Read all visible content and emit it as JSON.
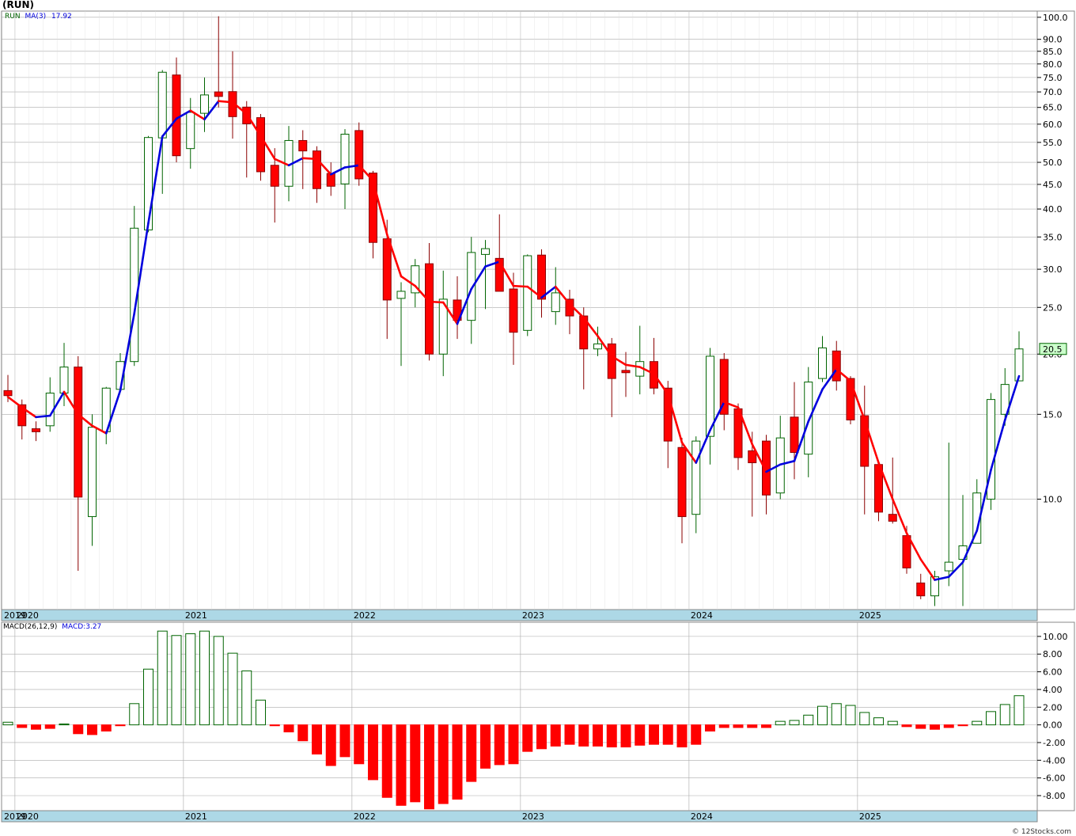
{
  "title": "(RUN)",
  "copyright": "© 12Stocks.com",
  "colors": {
    "up_candle_fill": "#ffffff",
    "up_candle_stroke": "#006400",
    "down_candle_fill": "#ff0000",
    "down_candle_stroke": "#8b0000",
    "ma_up": "#0000dd",
    "ma_down": "#ff0000",
    "macd_pos_fill": "#ffffff",
    "macd_pos_stroke": "#006400",
    "macd_neg_fill": "#ff0000",
    "grid": "#aaaaaa",
    "axis_band": "#add8e6",
    "last_price_box": "#ccffcc"
  },
  "legend": {
    "symbol": "RUN",
    "ma_label": "MA(3)",
    "ma_value": "17.92",
    "macd_label": "MACD(26,12,9)",
    "macd_value": "MACD:3.27"
  },
  "last_price_label": "20.5",
  "chart_data": [
    {
      "type": "candlestick",
      "period": "monthly",
      "scale": "log",
      "ylim": [
        5.9,
        103
      ],
      "y_ticks": [
        "100.0",
        "90.0",
        "85.0",
        "80.0",
        "75.0",
        "70.0",
        "65.0",
        "60.0",
        "55.0",
        "50.0",
        "45.0",
        "40.0",
        "35.0",
        "30.0",
        "25.0",
        "20.0",
        "15.0",
        "10.0"
      ],
      "x_year_labels": [
        "2019",
        "2020",
        "2021",
        "2022",
        "2023",
        "2024",
        "2025"
      ],
      "x_year_month_index": [
        0,
        1,
        13,
        25,
        37,
        49,
        61
      ],
      "ohlc": [
        [
          16.8,
          18.1,
          15.9,
          16.4
        ],
        [
          15.7,
          16.1,
          13.3,
          14.2
        ],
        [
          14.0,
          14.5,
          13.2,
          13.8
        ],
        [
          14.2,
          17.9,
          13.8,
          16.6
        ],
        [
          16.6,
          21.1,
          15.6,
          18.8
        ],
        [
          18.8,
          19.8,
          7.1,
          10.1
        ],
        [
          9.2,
          15.0,
          8.0,
          14.1
        ],
        [
          13.8,
          17.1,
          13.0,
          17.0
        ],
        [
          16.9,
          20.1,
          16.7,
          19.3
        ],
        [
          19.3,
          40.6,
          18.9,
          36.5
        ],
        [
          36.2,
          56.7,
          35.8,
          56.3
        ],
        [
          56.2,
          77.7,
          43.0,
          76.9
        ],
        [
          75.9,
          82.5,
          50.0,
          51.6
        ],
        [
          53.4,
          68.0,
          48.5,
          63.5
        ],
        [
          63.2,
          75.0,
          57.8,
          69.0
        ],
        [
          70.0,
          100.5,
          65.0,
          68.5
        ],
        [
          70.1,
          85.0,
          56.0,
          62.2
        ],
        [
          65.1,
          67.0,
          46.5,
          60.1
        ],
        [
          61.9,
          63.0,
          45.8,
          47.8
        ],
        [
          49.3,
          53.5,
          37.5,
          44.6
        ],
        [
          44.6,
          59.5,
          41.5,
          55.5
        ],
        [
          55.5,
          58.3,
          44.0,
          52.8
        ],
        [
          52.8,
          54.0,
          41.2,
          44.1
        ],
        [
          47.4,
          50.0,
          42.6,
          44.6
        ],
        [
          45.1,
          58.6,
          40.0,
          57.2
        ],
        [
          58.2,
          60.5,
          44.7,
          46.2
        ],
        [
          47.5,
          48.0,
          31.6,
          34.1
        ],
        [
          34.7,
          38.0,
          21.5,
          25.9
        ],
        [
          26.1,
          28.2,
          18.9,
          27.0
        ],
        [
          26.8,
          31.5,
          25.0,
          30.5
        ],
        [
          30.8,
          34.0,
          19.4,
          20.0
        ],
        [
          20.0,
          29.8,
          18.0,
          26.0
        ],
        [
          25.9,
          29.0,
          21.5,
          23.5
        ],
        [
          23.5,
          35.0,
          21.0,
          32.5
        ],
        [
          32.2,
          34.5,
          24.8,
          33.1
        ],
        [
          31.6,
          39.0,
          27.4,
          27.0
        ],
        [
          27.3,
          29.5,
          19.0,
          22.2
        ],
        [
          22.4,
          32.2,
          21.8,
          32.0
        ],
        [
          32.1,
          33.0,
          23.8,
          26.0
        ],
        [
          24.5,
          30.3,
          23.0,
          26.8
        ],
        [
          26.0,
          27.2,
          22.0,
          24.0
        ],
        [
          24.0,
          25.0,
          16.9,
          20.5
        ],
        [
          20.5,
          22.8,
          19.8,
          21.0
        ],
        [
          21.0,
          21.6,
          14.8,
          17.8
        ],
        [
          18.5,
          20.2,
          16.3,
          18.3
        ],
        [
          18.0,
          22.9,
          16.5,
          19.3
        ],
        [
          19.3,
          21.6,
          16.5,
          17.0
        ],
        [
          17.0,
          17.6,
          11.6,
          13.2
        ],
        [
          12.8,
          13.4,
          8.1,
          9.2
        ],
        [
          9.3,
          13.5,
          8.5,
          13.2
        ],
        [
          13.5,
          20.6,
          11.8,
          19.8
        ],
        [
          19.5,
          20.1,
          13.9,
          15.0
        ],
        [
          15.4,
          15.8,
          11.5,
          12.2
        ],
        [
          12.6,
          13.8,
          9.2,
          11.9
        ],
        [
          13.2,
          13.6,
          9.3,
          10.2
        ],
        [
          10.3,
          14.9,
          10.0,
          13.4
        ],
        [
          14.8,
          17.5,
          11.0,
          12.5
        ],
        [
          12.4,
          18.8,
          11.1,
          17.5
        ],
        [
          17.8,
          21.8,
          17.5,
          20.6
        ],
        [
          20.3,
          21.3,
          16.8,
          17.6
        ],
        [
          17.8,
          18.0,
          14.3,
          14.6
        ],
        [
          14.9,
          17.2,
          9.3,
          11.7
        ],
        [
          11.8,
          12.0,
          9.0,
          9.4
        ],
        [
          9.3,
          12.2,
          8.9,
          9.0
        ],
        [
          8.4,
          8.8,
          7.0,
          7.2
        ],
        [
          6.7,
          7.0,
          6.2,
          6.3
        ],
        [
          6.3,
          7.1,
          6.0,
          6.9
        ],
        [
          7.1,
          13.1,
          6.6,
          7.4
        ],
        [
          7.5,
          10.2,
          6.0,
          8.0
        ],
        [
          8.1,
          11.0,
          8.2,
          10.3
        ],
        [
          10.0,
          16.6,
          9.5,
          16.1
        ],
        [
          15.0,
          18.7,
          14.2,
          17.3
        ],
        [
          17.6,
          22.3,
          18.6,
          20.5
        ]
      ],
      "ma3": [
        16.3,
        15.5,
        14.8,
        14.9,
        16.7,
        15.0,
        14.2,
        13.7,
        16.8,
        24.3,
        37.4,
        56.6,
        61.6,
        64.0,
        61.4,
        67.0,
        66.6,
        63.0,
        56.7,
        50.8,
        49.3,
        51.0,
        50.8,
        47.2,
        48.8,
        49.3,
        45.8,
        35.4,
        29.0,
        27.7,
        25.7,
        25.6,
        23.1,
        27.3,
        30.4,
        31.1,
        27.7,
        27.6,
        26.2,
        27.6,
        25.4,
        23.8,
        21.8,
        19.8,
        19.0,
        18.8,
        18.2,
        16.5,
        13.1,
        11.9,
        13.9,
        15.9,
        15.5,
        13.0,
        11.4,
        11.8,
        12.0,
        14.5,
        16.9,
        18.6,
        17.6,
        14.6,
        11.9,
        10.0,
        8.5,
        7.5,
        6.8,
        6.9,
        7.4,
        8.6,
        11.5,
        14.6,
        18.0
      ],
      "macd": [
        0.3,
        -0.3,
        -0.5,
        -0.4,
        0.1,
        -1.0,
        -1.1,
        -0.7,
        -0.1,
        2.4,
        6.3,
        10.6,
        10.1,
        10.3,
        10.6,
        10.0,
        8.1,
        6.1,
        2.8,
        -0.1,
        -0.8,
        -1.8,
        -3.3,
        -4.6,
        -3.6,
        -4.4,
        -6.2,
        -8.2,
        -9.1,
        -8.7,
        -9.5,
        -8.9,
        -8.4,
        -6.4,
        -4.9,
        -4.5,
        -4.4,
        -3.0,
        -2.7,
        -2.4,
        -2.2,
        -2.4,
        -2.4,
        -2.5,
        -2.5,
        -2.3,
        -2.2,
        -2.2,
        -2.5,
        -2.2,
        -0.7,
        -0.3,
        -0.3,
        -0.3,
        -0.3,
        0.4,
        0.5,
        1.1,
        2.1,
        2.4,
        2.2,
        1.4,
        0.8,
        0.4,
        -0.2,
        -0.4,
        -0.5,
        -0.3,
        -0.1,
        0.4,
        1.5,
        2.3,
        3.3
      ],
      "macd_ylim": [
        -9.7,
        11.6
      ],
      "macd_ticks": [
        "10.00",
        "8.00",
        "6.00",
        "4.00",
        "2.00",
        "0.00",
        "-2.00",
        "-4.00",
        "-6.00",
        "-8.00"
      ],
      "macd_tick_values": [
        10,
        8,
        6,
        4,
        2,
        0,
        -2,
        -4,
        -6,
        -8
      ]
    }
  ]
}
